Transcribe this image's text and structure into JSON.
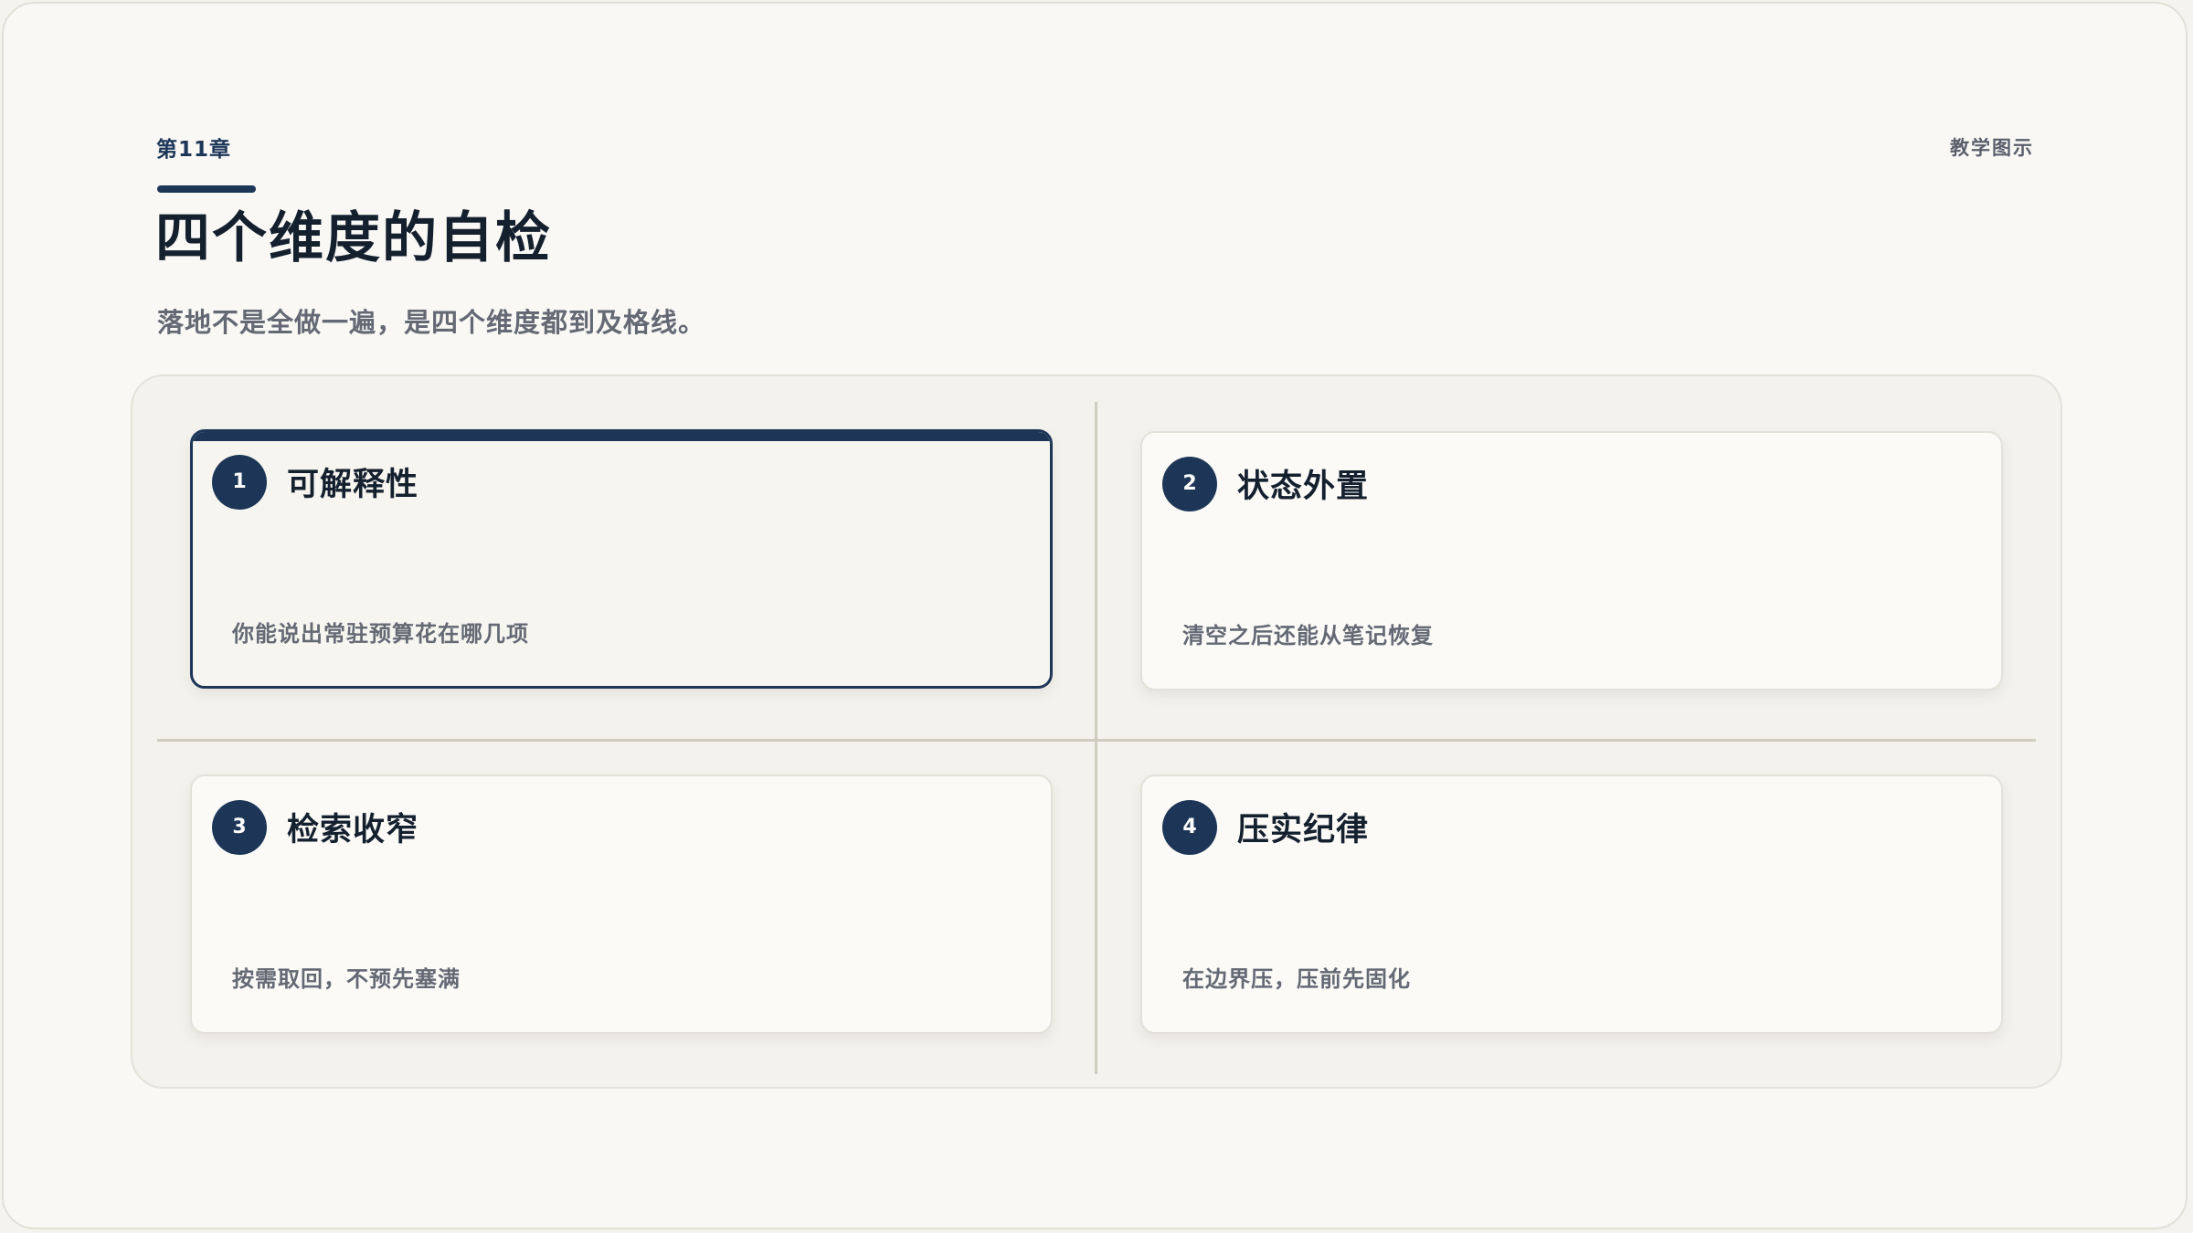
{
  "header": {
    "chapter": "第11章",
    "tag": "教学图示",
    "title": "四个维度的自检",
    "subtitle": "落地不是全做一遍，是四个维度都到及格线。"
  },
  "quadrants": [
    {
      "number": "1",
      "title": "可解释性",
      "description": "你能说出常驻预算花在哪几项",
      "highlighted": true
    },
    {
      "number": "2",
      "title": "状态外置",
      "description": "清空之后还能从笔记恢复",
      "highlighted": false
    },
    {
      "number": "3",
      "title": "检索收窄",
      "description": "按需取回，不预先塞满",
      "highlighted": false
    },
    {
      "number": "4",
      "title": "压实纪律",
      "description": "在边界压，压前先固化",
      "highlighted": false
    }
  ],
  "colors": {
    "accent": "#1d3658",
    "background": "#f9f8f5",
    "card": "#fbfaf7",
    "title_text": "#15202f",
    "muted_text": "#646974"
  }
}
